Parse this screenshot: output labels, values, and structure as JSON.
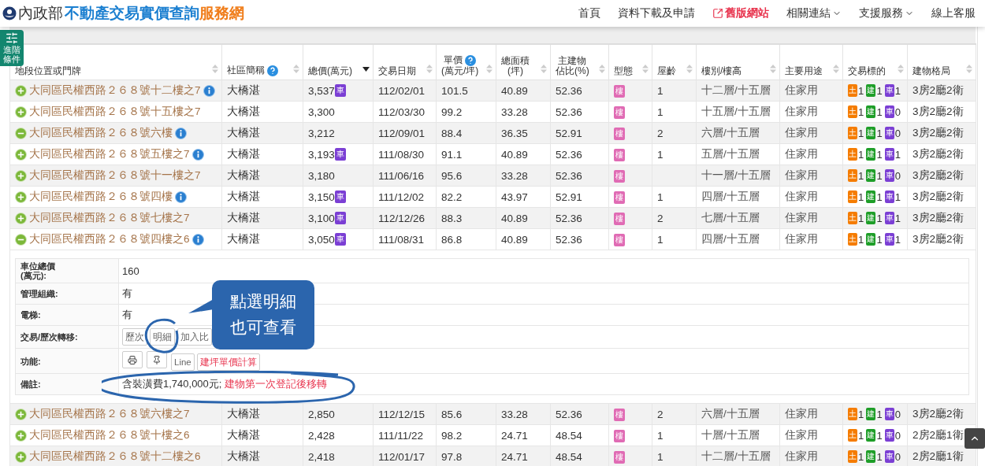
{
  "header": {
    "logo_left": "內政部",
    "logo_main": "不動產交易實價查詢",
    "logo_accent": "服務網",
    "nav": [
      {
        "label": "首頁",
        "kind": "plain"
      },
      {
        "label": "資料下載及申請",
        "kind": "plain"
      },
      {
        "label": "舊版網站",
        "kind": "external"
      },
      {
        "label": "相關連結",
        "kind": "menu"
      },
      {
        "label": "支援服務",
        "kind": "menu"
      },
      {
        "label": "線上客服",
        "kind": "plain"
      }
    ]
  },
  "filter_button": {
    "label": "進階條件"
  },
  "table": {
    "columns": [
      {
        "lines": [
          "地段位置或門牌"
        ],
        "sorted": false,
        "help": false
      },
      {
        "lines": [
          "社區簡稱"
        ],
        "sorted": false,
        "help": true
      },
      {
        "lines": [
          "總價(萬元)"
        ],
        "sorted": true,
        "help": false
      },
      {
        "lines": [
          "交易日期"
        ],
        "sorted": false,
        "help": false
      },
      {
        "lines": [
          "單價",
          "(萬元/坪)"
        ],
        "sorted": false,
        "help": true
      },
      {
        "lines": [
          "總面積",
          "(坪)"
        ],
        "sorted": false,
        "help": false
      },
      {
        "lines": [
          "主建物",
          "佔比(%)"
        ],
        "sorted": false,
        "help": false
      },
      {
        "lines": [
          "型態"
        ],
        "sorted": false,
        "help": false
      },
      {
        "lines": [
          "屋齡"
        ],
        "sorted": false,
        "help": false
      },
      {
        "lines": [
          "樓別/樓高"
        ],
        "sorted": false,
        "help": false
      },
      {
        "lines": [
          "主要用途"
        ],
        "sorted": false,
        "help": false
      },
      {
        "lines": [
          "交易標的"
        ],
        "sorted": false,
        "help": false
      },
      {
        "lines": [
          "建物格局"
        ],
        "sorted": false,
        "help": false
      }
    ],
    "rows": [
      {
        "expanded": false,
        "address": "大同區民權西路２６８號十二樓之7",
        "info": true,
        "community": "大橋湛",
        "price": "3,537",
        "badge": "車",
        "date": "112/02/01",
        "unit_price": "101.5",
        "area": "40.89",
        "main_ratio": "52.36",
        "type": "樓",
        "age": "1",
        "floor": "十二層/十五層",
        "use": "住家用",
        "tags": [
          {
            "label": "土",
            "count": "1",
            "color": "#f57c00"
          },
          {
            "label": "建",
            "count": "1",
            "color": "#1e9e28"
          },
          {
            "label": "車",
            "count": "1",
            "color": "#7b3fd4"
          }
        ],
        "layout": "3房2廳2衛"
      },
      {
        "expanded": false,
        "address": "大同區民權西路２６８號十五樓之7",
        "info": false,
        "community": "大橋湛",
        "price": "3,300",
        "date": "112/03/30",
        "unit_price": "99.2",
        "area": "33.28",
        "main_ratio": "52.36",
        "type": "樓",
        "age": "1",
        "floor": "十五層/十五層",
        "use": "住家用",
        "tags": [
          {
            "label": "土",
            "count": "1",
            "color": "#f57c00"
          },
          {
            "label": "建",
            "count": "1",
            "color": "#1e9e28"
          },
          {
            "label": "車",
            "count": "0",
            "color": "#7b3fd4"
          }
        ],
        "layout": "3房2廳2衛"
      },
      {
        "expanded": true,
        "address": "大同區民權西路２６８號六樓",
        "info": true,
        "community": "大橋湛",
        "price": "3,212",
        "date": "112/09/01",
        "unit_price": "88.4",
        "area": "36.35",
        "main_ratio": "52.91",
        "type": "樓",
        "age": "2",
        "floor": "六層/十五層",
        "use": "住家用",
        "tags": [
          {
            "label": "土",
            "count": "1",
            "color": "#f57c00"
          },
          {
            "label": "建",
            "count": "1",
            "color": "#1e9e28"
          },
          {
            "label": "車",
            "count": "0",
            "color": "#7b3fd4"
          }
        ],
        "layout": "3房2廳2衛"
      },
      {
        "expanded": false,
        "address": "大同區民權西路２６８號五樓之7",
        "info": true,
        "community": "大橋湛",
        "price": "3,193",
        "badge": "車",
        "date": "111/08/30",
        "unit_price": "91.1",
        "area": "40.89",
        "main_ratio": "52.36",
        "type": "樓",
        "age": "1",
        "floor": "五層/十五層",
        "use": "住家用",
        "tags": [
          {
            "label": "土",
            "count": "1",
            "color": "#f57c00"
          },
          {
            "label": "建",
            "count": "1",
            "color": "#1e9e28"
          },
          {
            "label": "車",
            "count": "1",
            "color": "#7b3fd4"
          }
        ],
        "layout": "3房2廳2衛"
      },
      {
        "expanded": false,
        "address": "大同區民權西路２６８號十一樓之7",
        "info": false,
        "community": "大橋湛",
        "price": "3,180",
        "date": "111/06/16",
        "unit_price": "95.6",
        "area": "33.28",
        "main_ratio": "52.36",
        "type": "樓",
        "floor": "十一層/十五層",
        "use": "住家用",
        "tags": [
          {
            "label": "土",
            "count": "1",
            "color": "#f57c00"
          },
          {
            "label": "建",
            "count": "1",
            "color": "#1e9e28"
          },
          {
            "label": "車",
            "count": "0",
            "color": "#7b3fd4"
          }
        ],
        "layout": "3房2廳2衛"
      },
      {
        "expanded": false,
        "address": "大同區民權西路２６８號四樓",
        "info": true,
        "community": "大橋湛",
        "price": "3,150",
        "badge": "車",
        "date": "111/12/02",
        "unit_price": "82.2",
        "area": "43.97",
        "main_ratio": "52.91",
        "type": "樓",
        "age": "1",
        "floor": "四層/十五層",
        "use": "住家用",
        "tags": [
          {
            "label": "土",
            "count": "1",
            "color": "#f57c00"
          },
          {
            "label": "建",
            "count": "1",
            "color": "#1e9e28"
          },
          {
            "label": "車",
            "count": "1",
            "color": "#7b3fd4"
          }
        ],
        "layout": "3房2廳2衛"
      },
      {
        "expanded": false,
        "address": "大同區民權西路２６８號七樓之7",
        "info": false,
        "community": "大橋湛",
        "price": "3,100",
        "badge": "車",
        "date": "112/12/26",
        "unit_price": "88.3",
        "area": "40.89",
        "main_ratio": "52.36",
        "type": "樓",
        "age": "2",
        "floor": "七層/十五層",
        "use": "住家用",
        "tags": [
          {
            "label": "土",
            "count": "1",
            "color": "#f57c00"
          },
          {
            "label": "建",
            "count": "1",
            "color": "#1e9e28"
          },
          {
            "label": "車",
            "count": "1",
            "color": "#7b3fd4"
          }
        ],
        "layout": "3房2廳2衛"
      },
      {
        "expanded": true,
        "address": "大同區民權西路２６８號四樓之6",
        "info": true,
        "community": "大橋湛",
        "price": "3,050",
        "badge": "車",
        "date": "111/08/31",
        "unit_price": "86.8",
        "area": "40.89",
        "main_ratio": "52.36",
        "type": "樓",
        "age": "1",
        "floor": "四層/十五層",
        "use": "住家用",
        "tags": [
          {
            "label": "土",
            "count": "1",
            "color": "#f57c00"
          },
          {
            "label": "建",
            "count": "1",
            "color": "#1e9e28"
          },
          {
            "label": "車",
            "count": "1",
            "color": "#7b3fd4"
          }
        ],
        "layout": "3房2廳2衛",
        "detail": {
          "rows": [
            {
              "kind": "text",
              "lines": [
                "車位總價",
                "(萬元):"
              ],
              "value": "160"
            },
            {
              "kind": "text",
              "lines": [
                "管理組織:"
              ],
              "value": "有"
            },
            {
              "kind": "text",
              "lines": [
                "電梯:"
              ],
              "value": "有"
            },
            {
              "kind": "buttons",
              "lines": [
                "交易/歷次轉移:"
              ],
              "buttons": [
                {
                  "label": "歷次",
                  "kind": "text"
                },
                {
                  "label": "明細",
                  "kind": "text"
                },
                {
                  "label": "加入比",
                  "kind": "text"
                }
              ]
            },
            {
              "kind": "buttons",
              "lines": [
                "功能:"
              ],
              "buttons": [
                {
                  "kind": "print"
                },
                {
                  "kind": "pin"
                },
                {
                  "label": "Line",
                  "kind": "text"
                },
                {
                  "label": "建坪單價計算",
                  "kind": "alert"
                }
              ]
            },
            {
              "kind": "remark",
              "lines": [
                "備註:"
              ],
              "value": "含裝潢費1,740,000元;",
              "alert": "建物第一次登記後移轉"
            }
          ],
          "callout": "點選明細也可查看"
        }
      },
      {
        "expanded": false,
        "address": "大同區民權西路２６８號六樓之7",
        "info": false,
        "community": "大橋湛",
        "price": "2,850",
        "date": "112/12/15",
        "unit_price": "85.6",
        "area": "33.28",
        "main_ratio": "52.36",
        "type": "樓",
        "age": "2",
        "floor": "六層/十五層",
        "use": "住家用",
        "tags": [
          {
            "label": "土",
            "count": "1",
            "color": "#f57c00"
          },
          {
            "label": "建",
            "count": "1",
            "color": "#1e9e28"
          },
          {
            "label": "車",
            "count": "0",
            "color": "#7b3fd4"
          }
        ],
        "layout": "3房2廳2衛"
      },
      {
        "expanded": false,
        "address": "大同區民權西路２６８號十樓之6",
        "info": false,
        "community": "大橋湛",
        "price": "2,428",
        "date": "111/11/22",
        "unit_price": "98.2",
        "area": "24.71",
        "main_ratio": "48.54",
        "type": "樓",
        "age": "1",
        "floor": "十層/十五層",
        "use": "住家用",
        "tags": [
          {
            "label": "土",
            "count": "1",
            "color": "#f57c00"
          },
          {
            "label": "建",
            "count": "1",
            "color": "#1e9e28"
          },
          {
            "label": "車",
            "count": "0",
            "color": "#7b3fd4"
          }
        ],
        "layout": "2房2廳1衛"
      },
      {
        "expanded": false,
        "address": "大同區民權西路２６８號十二樓之6",
        "info": false,
        "community": "大橋湛",
        "price": "2,418",
        "date": "112/01/17",
        "unit_price": "97.8",
        "area": "24.71",
        "main_ratio": "48.54",
        "type": "樓",
        "age": "1",
        "floor": "十二層/十五層",
        "use": "住家用",
        "tags": [
          {
            "label": "土",
            "count": "1",
            "color": "#f57c00"
          },
          {
            "label": "建",
            "count": "1",
            "color": "#1e9e28"
          },
          {
            "label": "車",
            "count": "0",
            "color": "#7b3fd4"
          }
        ],
        "layout": "2房2廳1衛"
      }
    ]
  }
}
